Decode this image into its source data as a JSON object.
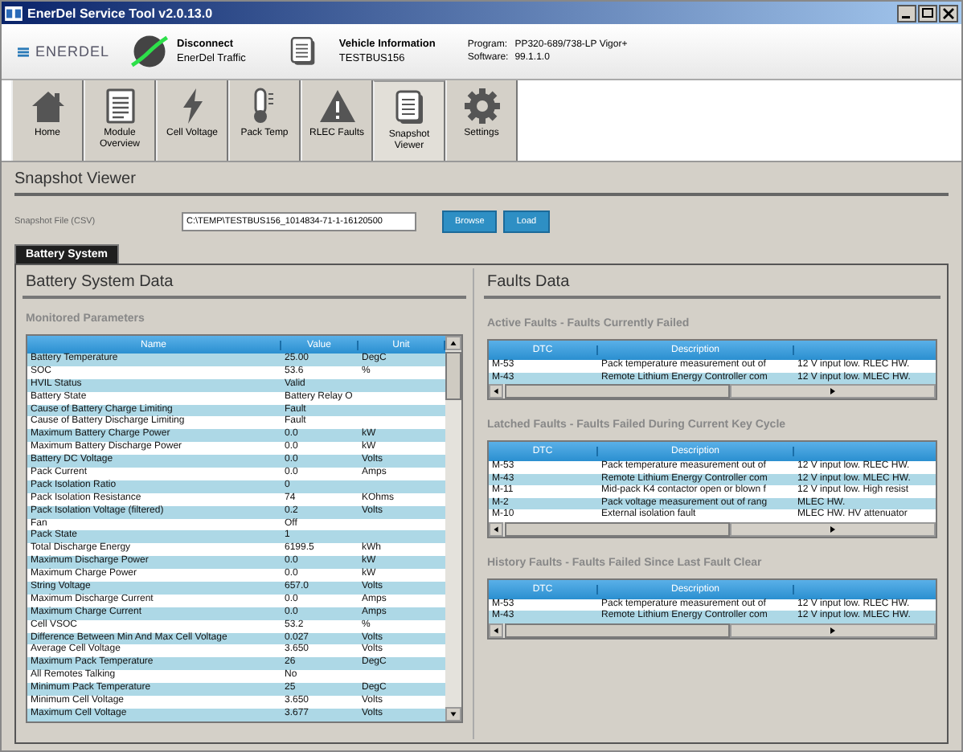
{
  "window": {
    "title": "EnerDel Service Tool v2.0.13.0"
  },
  "header": {
    "logo": "ENERDEL",
    "connection": {
      "title": "Disconnect",
      "subtitle": "EnerDel Traffic"
    },
    "vehicle": {
      "title": "Vehicle Information",
      "subtitle": "TESTBUS156"
    },
    "program_label": "Program:",
    "program": "PP320-689/738-LP Vigor+",
    "software_label": "Software:",
    "software": "99.1.1.0"
  },
  "nav": [
    {
      "label": "Home",
      "selected": false
    },
    {
      "label": "Module Overview",
      "selected": false
    },
    {
      "label": "Cell Voltage",
      "selected": false
    },
    {
      "label": "Pack Temp",
      "selected": false
    },
    {
      "label": "RLEC Faults",
      "selected": false
    },
    {
      "label": "Snapshot Viewer",
      "selected": true
    },
    {
      "label": "Settings",
      "selected": false
    }
  ],
  "page_title": "Snapshot Viewer",
  "file": {
    "label": "Snapshot File (CSV)",
    "value": "C:\\TEMP\\TESTBUS156_1014834-71-1-16120500",
    "buttons": [
      "Browse",
      "Load"
    ]
  },
  "tabs": [
    {
      "label": "Battery System",
      "selected": true
    }
  ],
  "battery": {
    "title": "Battery System Data",
    "section": "Monitored Parameters",
    "columns": [
      "Name",
      "Value",
      "Unit"
    ],
    "rows": [
      {
        "name": "Battery Temperature",
        "value": "25.00",
        "unit": "DegC"
      },
      {
        "name": "SOC",
        "value": "53.6",
        "unit": "%"
      },
      {
        "name": "HVIL Status",
        "value": "Valid"
      },
      {
        "name": "Battery State",
        "value": "Battery Relay O"
      },
      {
        "name": "Cause of Battery Charge Limiting",
        "value": "Fault"
      },
      {
        "name": "Cause of Battery Discharge Limiting",
        "value": "Fault"
      },
      {
        "name": "Maximum Battery Charge Power",
        "value": "0.0",
        "unit": "kW"
      },
      {
        "name": "Maximum Battery Discharge Power",
        "value": "0.0",
        "unit": "kW"
      },
      {
        "name": "Battery DC Voltage",
        "value": "0.0",
        "unit": "Volts"
      },
      {
        "name": "Pack Current",
        "value": "0.0",
        "unit": "Amps"
      },
      {
        "name": "Pack Isolation Ratio",
        "value": "0"
      },
      {
        "name": "Pack Isolation Resistance",
        "value": "74",
        "unit": "KOhms"
      },
      {
        "name": "Pack Isolation Voltage (filtered)",
        "value": "0.2",
        "unit": "Volts"
      },
      {
        "name": "Fan",
        "value": "Off"
      },
      {
        "name": "Pack State",
        "value": "1"
      },
      {
        "name": "Total Discharge Energy",
        "value": "6199.5",
        "unit": "kWh"
      },
      {
        "name": "Maximum Discharge Power",
        "value": "0.0",
        "unit": "kW"
      },
      {
        "name": "Maximum Charge Power",
        "value": "0.0",
        "unit": "kW"
      },
      {
        "name": "String Voltage",
        "value": "657.0",
        "unit": "Volts"
      },
      {
        "name": "Maximum Discharge Current",
        "value": "0.0",
        "unit": "Amps"
      },
      {
        "name": "Maximum Charge Current",
        "value": "0.0",
        "unit": "Amps"
      },
      {
        "name": "Cell VSOC",
        "value": "53.2",
        "unit": "%"
      },
      {
        "name": "Difference Between Min And Max Cell Voltage",
        "value": "0.027",
        "unit": "Volts"
      },
      {
        "name": "Average Cell Voltage",
        "value": "3.650",
        "unit": "Volts"
      },
      {
        "name": "Maximum Pack Temperature",
        "value": "26",
        "unit": "DegC"
      },
      {
        "name": "All Remotes Talking",
        "value": "No"
      },
      {
        "name": "Minimum Pack Temperature",
        "value": "25",
        "unit": "DegC"
      },
      {
        "name": "Minimum Cell Voltage",
        "value": "3.650",
        "unit": "Volts"
      },
      {
        "name": "Maximum Cell Voltage",
        "value": "3.677",
        "unit": "Volts"
      }
    ]
  },
  "faults": {
    "title": "Faults Data",
    "tables": [
      {
        "title": "Active Faults - Faults Currently Failed",
        "columns": [
          "DTC",
          "Description"
        ],
        "rows": [
          {
            "dtc": "M-53",
            "description": "Pack temperature measurement out of",
            "column_3": "12 V input low.  RLEC HW."
          },
          {
            "dtc": "M-43",
            "description": "Remote Lithium Energy Controller com",
            "column_3": "12 V input low.  MLEC HW."
          }
        ]
      },
      {
        "title": "Latched Faults - Faults Failed During Current Key Cycle",
        "columns": [
          "DTC",
          "Description"
        ],
        "rows": [
          {
            "dtc": "M-53",
            "description": "Pack temperature measurement out of",
            "column_3": "12 V input low.  RLEC HW."
          },
          {
            "dtc": "M-43",
            "description": "Remote Lithium Energy Controller com",
            "column_3": "12 V input low.  MLEC HW."
          },
          {
            "dtc": "M-11",
            "description": "Mid-pack K4 contactor open or blown f",
            "column_3": "12 V input low.  High resist"
          },
          {
            "dtc": "M-2",
            "description": "Pack voltage measurement out of rang",
            "column_3": "MLEC HW."
          },
          {
            "dtc": "M-10",
            "description": "External isolation fault",
            "column_3": "MLEC HW.  HV attenuator"
          }
        ]
      },
      {
        "title": "History Faults - Faults Failed Since Last Fault Clear",
        "columns": [
          "DTC",
          "Description"
        ],
        "rows": [
          {
            "dtc": "M-53",
            "description": "Pack temperature measurement out of",
            "column_3": "12 V input low.  RLEC HW."
          },
          {
            "dtc": "M-43",
            "description": "Remote Lithium Energy Controller com",
            "column_3": "12 V input low.  MLEC HW."
          }
        ]
      }
    ]
  }
}
